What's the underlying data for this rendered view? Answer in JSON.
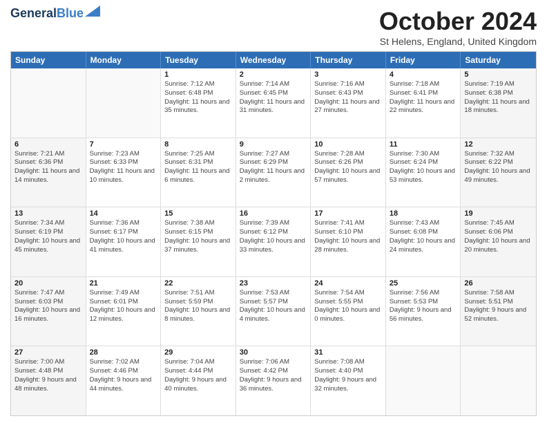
{
  "header": {
    "logo_line1": "General",
    "logo_line2": "Blue",
    "month": "October 2024",
    "location": "St Helens, England, United Kingdom"
  },
  "weekdays": [
    "Sunday",
    "Monday",
    "Tuesday",
    "Wednesday",
    "Thursday",
    "Friday",
    "Saturday"
  ],
  "rows": [
    [
      {
        "day": "",
        "sunrise": "",
        "sunset": "",
        "daylight": "",
        "empty": true
      },
      {
        "day": "",
        "sunrise": "",
        "sunset": "",
        "daylight": "",
        "empty": true
      },
      {
        "day": "1",
        "sunrise": "Sunrise: 7:12 AM",
        "sunset": "Sunset: 6:48 PM",
        "daylight": "Daylight: 11 hours and 35 minutes.",
        "empty": false
      },
      {
        "day": "2",
        "sunrise": "Sunrise: 7:14 AM",
        "sunset": "Sunset: 6:45 PM",
        "daylight": "Daylight: 11 hours and 31 minutes.",
        "empty": false
      },
      {
        "day": "3",
        "sunrise": "Sunrise: 7:16 AM",
        "sunset": "Sunset: 6:43 PM",
        "daylight": "Daylight: 11 hours and 27 minutes.",
        "empty": false
      },
      {
        "day": "4",
        "sunrise": "Sunrise: 7:18 AM",
        "sunset": "Sunset: 6:41 PM",
        "daylight": "Daylight: 11 hours and 22 minutes.",
        "empty": false
      },
      {
        "day": "5",
        "sunrise": "Sunrise: 7:19 AM",
        "sunset": "Sunset: 6:38 PM",
        "daylight": "Daylight: 11 hours and 18 minutes.",
        "empty": false
      }
    ],
    [
      {
        "day": "6",
        "sunrise": "Sunrise: 7:21 AM",
        "sunset": "Sunset: 6:36 PM",
        "daylight": "Daylight: 11 hours and 14 minutes.",
        "empty": false
      },
      {
        "day": "7",
        "sunrise": "Sunrise: 7:23 AM",
        "sunset": "Sunset: 6:33 PM",
        "daylight": "Daylight: 11 hours and 10 minutes.",
        "empty": false
      },
      {
        "day": "8",
        "sunrise": "Sunrise: 7:25 AM",
        "sunset": "Sunset: 6:31 PM",
        "daylight": "Daylight: 11 hours and 6 minutes.",
        "empty": false
      },
      {
        "day": "9",
        "sunrise": "Sunrise: 7:27 AM",
        "sunset": "Sunset: 6:29 PM",
        "daylight": "Daylight: 11 hours and 2 minutes.",
        "empty": false
      },
      {
        "day": "10",
        "sunrise": "Sunrise: 7:28 AM",
        "sunset": "Sunset: 6:26 PM",
        "daylight": "Daylight: 10 hours and 57 minutes.",
        "empty": false
      },
      {
        "day": "11",
        "sunrise": "Sunrise: 7:30 AM",
        "sunset": "Sunset: 6:24 PM",
        "daylight": "Daylight: 10 hours and 53 minutes.",
        "empty": false
      },
      {
        "day": "12",
        "sunrise": "Sunrise: 7:32 AM",
        "sunset": "Sunset: 6:22 PM",
        "daylight": "Daylight: 10 hours and 49 minutes.",
        "empty": false
      }
    ],
    [
      {
        "day": "13",
        "sunrise": "Sunrise: 7:34 AM",
        "sunset": "Sunset: 6:19 PM",
        "daylight": "Daylight: 10 hours and 45 minutes.",
        "empty": false
      },
      {
        "day": "14",
        "sunrise": "Sunrise: 7:36 AM",
        "sunset": "Sunset: 6:17 PM",
        "daylight": "Daylight: 10 hours and 41 minutes.",
        "empty": false
      },
      {
        "day": "15",
        "sunrise": "Sunrise: 7:38 AM",
        "sunset": "Sunset: 6:15 PM",
        "daylight": "Daylight: 10 hours and 37 minutes.",
        "empty": false
      },
      {
        "day": "16",
        "sunrise": "Sunrise: 7:39 AM",
        "sunset": "Sunset: 6:12 PM",
        "daylight": "Daylight: 10 hours and 33 minutes.",
        "empty": false
      },
      {
        "day": "17",
        "sunrise": "Sunrise: 7:41 AM",
        "sunset": "Sunset: 6:10 PM",
        "daylight": "Daylight: 10 hours and 28 minutes.",
        "empty": false
      },
      {
        "day": "18",
        "sunrise": "Sunrise: 7:43 AM",
        "sunset": "Sunset: 6:08 PM",
        "daylight": "Daylight: 10 hours and 24 minutes.",
        "empty": false
      },
      {
        "day": "19",
        "sunrise": "Sunrise: 7:45 AM",
        "sunset": "Sunset: 6:06 PM",
        "daylight": "Daylight: 10 hours and 20 minutes.",
        "empty": false
      }
    ],
    [
      {
        "day": "20",
        "sunrise": "Sunrise: 7:47 AM",
        "sunset": "Sunset: 6:03 PM",
        "daylight": "Daylight: 10 hours and 16 minutes.",
        "empty": false
      },
      {
        "day": "21",
        "sunrise": "Sunrise: 7:49 AM",
        "sunset": "Sunset: 6:01 PM",
        "daylight": "Daylight: 10 hours and 12 minutes.",
        "empty": false
      },
      {
        "day": "22",
        "sunrise": "Sunrise: 7:51 AM",
        "sunset": "Sunset: 5:59 PM",
        "daylight": "Daylight: 10 hours and 8 minutes.",
        "empty": false
      },
      {
        "day": "23",
        "sunrise": "Sunrise: 7:53 AM",
        "sunset": "Sunset: 5:57 PM",
        "daylight": "Daylight: 10 hours and 4 minutes.",
        "empty": false
      },
      {
        "day": "24",
        "sunrise": "Sunrise: 7:54 AM",
        "sunset": "Sunset: 5:55 PM",
        "daylight": "Daylight: 10 hours and 0 minutes.",
        "empty": false
      },
      {
        "day": "25",
        "sunrise": "Sunrise: 7:56 AM",
        "sunset": "Sunset: 5:53 PM",
        "daylight": "Daylight: 9 hours and 56 minutes.",
        "empty": false
      },
      {
        "day": "26",
        "sunrise": "Sunrise: 7:58 AM",
        "sunset": "Sunset: 5:51 PM",
        "daylight": "Daylight: 9 hours and 52 minutes.",
        "empty": false
      }
    ],
    [
      {
        "day": "27",
        "sunrise": "Sunrise: 7:00 AM",
        "sunset": "Sunset: 4:48 PM",
        "daylight": "Daylight: 9 hours and 48 minutes.",
        "empty": false
      },
      {
        "day": "28",
        "sunrise": "Sunrise: 7:02 AM",
        "sunset": "Sunset: 4:46 PM",
        "daylight": "Daylight: 9 hours and 44 minutes.",
        "empty": false
      },
      {
        "day": "29",
        "sunrise": "Sunrise: 7:04 AM",
        "sunset": "Sunset: 4:44 PM",
        "daylight": "Daylight: 9 hours and 40 minutes.",
        "empty": false
      },
      {
        "day": "30",
        "sunrise": "Sunrise: 7:06 AM",
        "sunset": "Sunset: 4:42 PM",
        "daylight": "Daylight: 9 hours and 36 minutes.",
        "empty": false
      },
      {
        "day": "31",
        "sunrise": "Sunrise: 7:08 AM",
        "sunset": "Sunset: 4:40 PM",
        "daylight": "Daylight: 9 hours and 32 minutes.",
        "empty": false
      },
      {
        "day": "",
        "sunrise": "",
        "sunset": "",
        "daylight": "",
        "empty": true
      },
      {
        "day": "",
        "sunrise": "",
        "sunset": "",
        "daylight": "",
        "empty": true
      }
    ]
  ]
}
